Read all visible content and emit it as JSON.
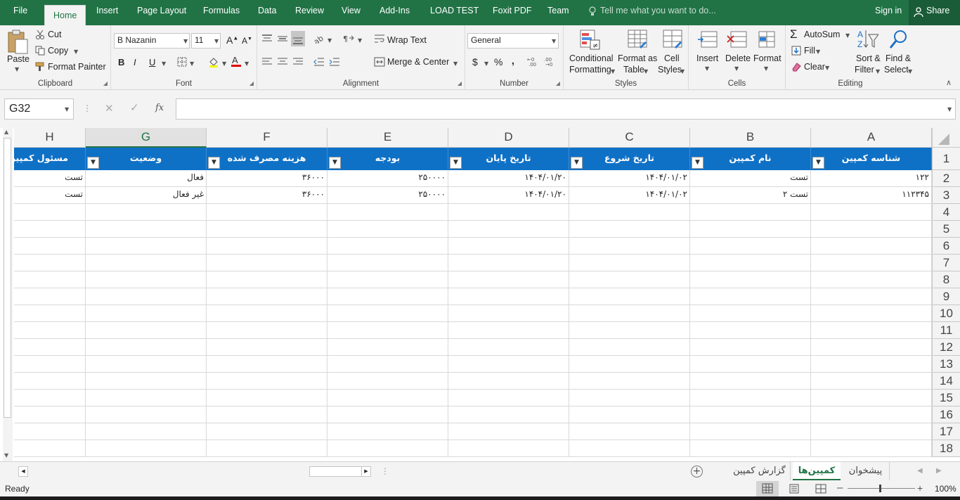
{
  "menu": {
    "tabs": [
      "File",
      "Home",
      "Insert",
      "Page Layout",
      "Formulas",
      "Data",
      "Review",
      "View",
      "Add-Ins",
      "LOAD TEST",
      "Foxit PDF",
      "Team"
    ],
    "tell_me": "Tell me what you want to do...",
    "sign_in": "Sign in",
    "share": "Share"
  },
  "ribbon": {
    "clipboard": {
      "paste": "Paste",
      "cut": "Cut",
      "copy": "Copy",
      "format_painter": "Format Painter",
      "label": "Clipboard"
    },
    "font": {
      "name": "B Nazanin",
      "size": "11",
      "bold": "B",
      "italic": "I",
      "underline": "U",
      "label": "Font"
    },
    "alignment": {
      "wrap_text": "Wrap Text",
      "merge_center": "Merge & Center",
      "label": "Alignment"
    },
    "number": {
      "format": "General",
      "currency": "$",
      "percent": "%",
      "comma": ",",
      "label": "Number"
    },
    "styles": {
      "conditional": "Conditional",
      "conditional2": "Formatting",
      "format_table": "Format as",
      "format_table2": "Table",
      "cell_styles": "Cell",
      "cell_styles2": "Styles",
      "label": "Styles"
    },
    "cells": {
      "insert": "Insert",
      "delete": "Delete",
      "format": "Format",
      "label": "Cells"
    },
    "editing": {
      "autosum": "AutoSum",
      "fill": "Fill",
      "clear": "Clear",
      "sort": "Sort &",
      "sort2": "Filter",
      "find": "Find &",
      "find2": "Select",
      "label": "Editing"
    }
  },
  "formula_bar": {
    "name_box": "G32",
    "fx": "fx",
    "value": ""
  },
  "columns": [
    "A",
    "B",
    "C",
    "D",
    "E",
    "F",
    "G",
    "H"
  ],
  "header_row": [
    "شناسه کمپین",
    "نام کمپین",
    "تاریخ شروع",
    "تاریخ پایان",
    "بودجه",
    "هزینه مصرف شده",
    "وضعیت",
    "مسئول کمپین"
  ],
  "rows": [
    [
      "۱۲۲",
      "تست",
      "۱۴۰۴/۰۱/۰۲",
      "۱۴۰۴/۰۱/۲۰",
      "۲۵۰۰۰۰",
      "۳۶۰۰۰",
      "فعال",
      "تست"
    ],
    [
      "۱۱۲۳۴۵",
      "تست ۲",
      "۱۴۰۴/۰۱/۰۲",
      "۱۴۰۴/۰۱/۲۰",
      "۲۵۰۰۰۰",
      "۳۶۰۰۰",
      "غیر فعال",
      "تست"
    ]
  ],
  "row_numbers": [
    "1",
    "2",
    "3",
    "4",
    "5",
    "6",
    "7",
    "8",
    "9",
    "10",
    "11",
    "12",
    "13",
    "14",
    "15",
    "16",
    "17",
    "18"
  ],
  "sheets": [
    "گزارش کمپین",
    "کمپین‌ها",
    "پیشخوان"
  ],
  "active_sheet": "کمپین‌ها",
  "status": {
    "ready": "Ready",
    "zoom": "100%"
  },
  "colors": {
    "accent": "#217346",
    "header_fill": "#0f71c6"
  }
}
